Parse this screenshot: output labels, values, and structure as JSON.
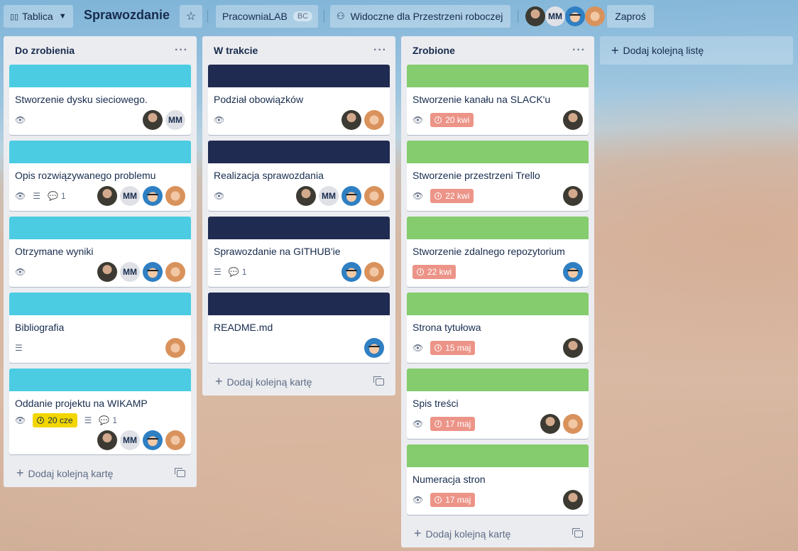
{
  "header": {
    "board_menu_label": "Tablica",
    "board_title": "Sprawozdanie",
    "workspace_label": "PracowniaLAB",
    "workspace_badge": "BC",
    "visibility_label": "Widoczne dla Przestrzeni roboczej",
    "member_initials": "MM",
    "invite_label": "Zaproś"
  },
  "lists": [
    {
      "title": "Do zrobienia",
      "menu": "···",
      "add_card": "Dodaj kolejną kartę",
      "cards": [
        {
          "title": "Stworzenie dysku sieciowego.",
          "cover": "#4bcce3",
          "mm": "MM"
        },
        {
          "title": "Opis rozwiązywanego problemu",
          "cover": "#4bcce3",
          "comments": "1",
          "mm": "MM"
        },
        {
          "title": "Otrzymane wyniki",
          "cover": "#4bcce3",
          "mm": "MM"
        },
        {
          "title": "Bibliografia",
          "cover": "#4bcce3"
        },
        {
          "title": "Oddanie projektu na WIKAMP",
          "cover": "#4bcce3",
          "due": "20 cze",
          "comments": "1",
          "mm": "MM"
        }
      ]
    },
    {
      "title": "W trakcie",
      "menu": "···",
      "add_card": "Dodaj kolejną kartę",
      "cards": [
        {
          "title": "Podział obowiązków",
          "cover": "#1f2b50"
        },
        {
          "title": "Realizacja sprawozdania",
          "cover": "#1f2b50",
          "mm": "MM"
        },
        {
          "title": "Sprawozdanie na GITHUB'ie",
          "cover": "#1f2b50",
          "comments": "1"
        },
        {
          "title": "README.md",
          "cover": "#1f2b50"
        }
      ]
    },
    {
      "title": "Zrobione",
      "menu": "···",
      "add_card": "Dodaj kolejną kartę",
      "cards": [
        {
          "title": "Stworzenie kanału na SLACK'u",
          "cover": "#84cc6e",
          "due": "20 kwi"
        },
        {
          "title": "Stworzenie przestrzeni Trello",
          "cover": "#84cc6e",
          "due": "22 kwi"
        },
        {
          "title": "Stworzenie zdalnego repozytorium",
          "cover": "#84cc6e",
          "due": "22 kwi"
        },
        {
          "title": "Strona tytułowa",
          "cover": "#84cc6e",
          "due": "15 maj"
        },
        {
          "title": "Spis treści",
          "cover": "#84cc6e",
          "due": "17 maj"
        },
        {
          "title": "Numeracja stron",
          "cover": "#84cc6e",
          "due": "17 maj"
        }
      ]
    }
  ],
  "add_list_label": "Dodaj kolejną listę",
  "colors": {
    "due_overdue": "#ec9488",
    "due_soon": "#f2d600",
    "list_bg": "#ebecf0"
  }
}
